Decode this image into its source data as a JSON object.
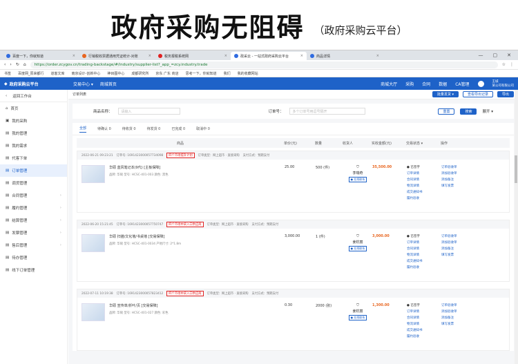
{
  "header": {
    "title": "政府采购无阻碍",
    "subtitle": "（政府采购云平台）"
  },
  "browser": {
    "tabs": [
      {
        "label": "百度一下，你就知道",
        "color": "#2f6be0"
      },
      {
        "label": "行销税收票据通用凭证统计-对账",
        "color": "#e8651f"
      },
      {
        "label": "税务报税系统网",
        "color": "#e02020"
      },
      {
        "label": "政采云 - 一站式政府采购云平台",
        "color": "#2f6be0",
        "active": true
      },
      {
        "label": "商品详情",
        "color": "#2f6be0"
      }
    ],
    "url": "https://order.zcygov.cn/trading-backstage/#/industry/supplier-list?_app_=zcy.industry.trade",
    "bookmarks": [
      "书签",
      "百度网_原来都行",
      "道客文库",
      "南京设计-创新中心",
      "神目图中心",
      "成都研究所",
      "京东 广东 商店",
      "思考一下，你就知道",
      "我们",
      "我的收藏网站"
    ]
  },
  "topbar": {
    "logo": "政府采购云平台",
    "menu1": "交易中心 ▾",
    "menu2": "商城首页",
    "links": [
      "商城大厅",
      "采购",
      "合同",
      "数据",
      "CA管理"
    ],
    "user": "王城",
    "org": "某公司有限公司"
  },
  "sidebar": {
    "back": "返回工作台",
    "items": [
      "首页",
      "我的采购",
      "我的管理",
      "我的需求",
      "代客下单",
      "订单管理",
      "调货管理",
      "合同管理",
      "履约管理",
      "结算管理",
      "发票管理",
      "售后管理",
      "待办管理",
      "线下订单管理"
    ]
  },
  "main": {
    "breadcrumb": "订单列表",
    "buttons": {
      "batch": "批量发货 ▾",
      "export": "查看导出记录",
      "exportBtn": "导出"
    },
    "filter": {
      "name_label": "商品名称：",
      "name_ph": "请输入",
      "order_label": "订单号：",
      "order_ph": "多个订单号用逗号隔开",
      "reset": "重置",
      "search": "搜索",
      "expand": "展开 ▾"
    },
    "status_tabs": [
      "全部",
      "待确认 0",
      "待收货 0",
      "待发货 0",
      "已完成 0",
      "取消中 0"
    ],
    "columns": [
      "商品",
      "单价(元)",
      "数量",
      "收货人",
      "实收金额(元)",
      "交易状态 ▾",
      "操作"
    ]
  },
  "orders": [
    {
      "time": "2022-06-21 09:23:21",
      "no": "订单号: 1691423000057734098",
      "tag": "四个市场提升计划",
      "type": "订单类型：网上超市 · 直接采购",
      "pay": "支付方式：预期支付",
      "name": "华硕 蓝风笔记本(9代) [主板保障]",
      "meta": "品牌: 华硕    型号: HCSC-401-003    颜色: 黑色",
      "price": "25.00",
      "qty": "500 (件)",
      "buyer": "李瑞奇",
      "total": "35,500.00",
      "status": [
        "● 已签字",
        "订单详情",
        "合同详情",
        "物流详情",
        "成交通知书",
        "履约验收"
      ],
      "ops": [
        "订单验收单",
        "添加验收单",
        "添加备注",
        "填写发票"
      ]
    },
    {
      "time": "2022-06-20 15:21:45",
      "no": "订单号: 1691423000057750747",
      "tag": "四个市场中采入口供应商",
      "type": "订单类型：网上超市 · 直接采购",
      "pay": "支付方式：预期支付",
      "name": "华硕 扫描/文化墙/书桌墙 [交易保障]",
      "meta": "品牌: 华硕    型号: HCSC-401-0034    产地尺寸: 2*1.8m",
      "price": "3,000.00",
      "qty": "1 (件)",
      "buyer": "姜杭丽",
      "total": "3,000.00",
      "status": [
        "● 已签字",
        "订单详情",
        "合同详情",
        "物流详情",
        "成交通知书",
        "履约验收"
      ],
      "ops": [
        "订单验收单",
        "添加验收单",
        "添加备注",
        "填写发票"
      ]
    },
    {
      "time": "2022-07-11 10:19:38",
      "no": "订单号: 1691423000057823412",
      "tag": "四个市场中采入口供应商",
      "type": "订单类型：网上超市 · 直接采购",
      "pay": "支付方式：预期支付",
      "name": "华硕 宣传单/折叶/页 [交易保障]",
      "meta": "品牌: 华硕    型号: HCSC-401-027    颜色: 彩色",
      "price": "0.30",
      "qty": "2000 (张)",
      "buyer": "姜杭丽",
      "total": "1,300.00",
      "status": [
        "● 已签字",
        "订单详情",
        "合同详情",
        "物流详情",
        "成交通知书",
        "履约验收"
      ],
      "ops": [
        "订单验收单",
        "添加验收单",
        "添加备注",
        "填写发票"
      ]
    }
  ]
}
